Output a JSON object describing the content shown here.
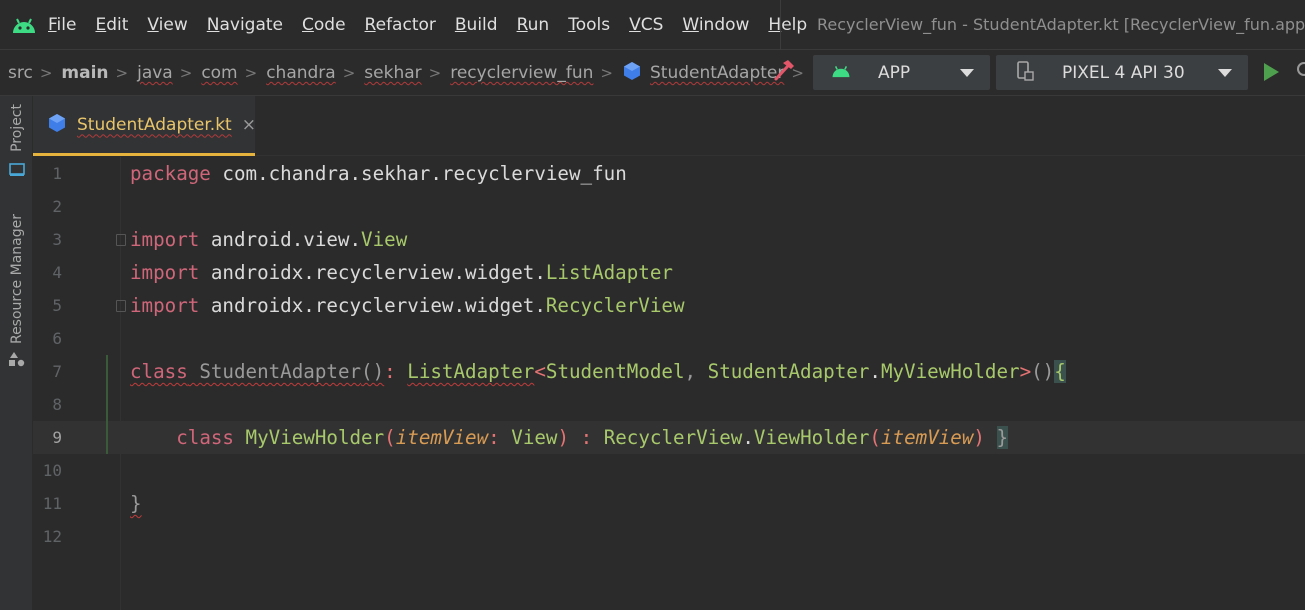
{
  "menu": {
    "items": [
      {
        "mn": "F",
        "rest": "ile"
      },
      {
        "mn": "E",
        "rest": "dit"
      },
      {
        "mn": "V",
        "rest": "iew"
      },
      {
        "mn": "N",
        "rest": "avigate"
      },
      {
        "mn": "C",
        "rest": "ode"
      },
      {
        "mn": "R",
        "rest": "efactor"
      },
      {
        "mn": "B",
        "rest": "uild"
      },
      {
        "mn": "R",
        "rest": "un"
      },
      {
        "mn": "T",
        "rest": "ools"
      },
      {
        "mn": "V",
        "rest": "CS"
      },
      {
        "mn": "W",
        "rest": "indow"
      },
      {
        "mn": "H",
        "rest": "elp"
      }
    ],
    "window_title": "RecyclerView_fun - StudentAdapter.kt [RecyclerView_fun.app.m"
  },
  "breadcrumb": [
    "src",
    "main",
    "java",
    "com",
    "chandra",
    "sekhar",
    "recyclerview_fun",
    "StudentAdapter"
  ],
  "toolbar": {
    "run_config": "APP",
    "device": "PIXEL 4 API 30"
  },
  "toolwindows": {
    "project": "Project",
    "resource_manager": "Resource Manager"
  },
  "tab": {
    "filename": "StudentAdapter.kt",
    "close": "×"
  },
  "editor": {
    "current_line": 9,
    "line_numbers": [
      "1",
      "2",
      "3",
      "4",
      "5",
      "6",
      "7",
      "8",
      "9",
      "10",
      "11",
      "12"
    ],
    "code": {
      "l1": {
        "kw": "package",
        "rest": " com.chandra.sekhar.recyclerview_fun"
      },
      "l3": {
        "kw": "import",
        "pkg": " android.view.",
        "type": "View"
      },
      "l4": {
        "kw": "import",
        "pkg": " androidx.recyclerview.widget.",
        "type": "ListAdapter"
      },
      "l5": {
        "kw": "import",
        "pkg": " androidx.recyclerview.widget.",
        "type": "RecyclerView"
      },
      "l7": {
        "kw": "class",
        "name": " StudentAdapter",
        "paren": "()",
        "colon": ": ",
        "super": "ListAdapter",
        "lt": "<",
        "t1": "StudentModel",
        "comma": ", ",
        "t2": "StudentAdapter",
        "dot": ".",
        "t3": "MyViewHolder",
        "gt": ">",
        "call": "()",
        "brace": "{"
      },
      "l9": {
        "indent": "    ",
        "kw": "class",
        "name": " MyViewHolder",
        "p1": "(",
        "param": "itemView",
        "colon": ": ",
        "ptype": "View",
        "p2": ")",
        "c2": " : ",
        "super": "RecyclerView",
        "dot": ".",
        "inner": "ViewHolder",
        "p3": "(",
        "arg": "itemView",
        "p4": ")",
        "sp": " ",
        "brace": "}"
      },
      "l11": {
        "brace": "}"
      }
    }
  },
  "colors": {
    "accent_tab": "#e6b43c",
    "run_green": "#4ea04e",
    "android_green": "#3ddc84"
  }
}
